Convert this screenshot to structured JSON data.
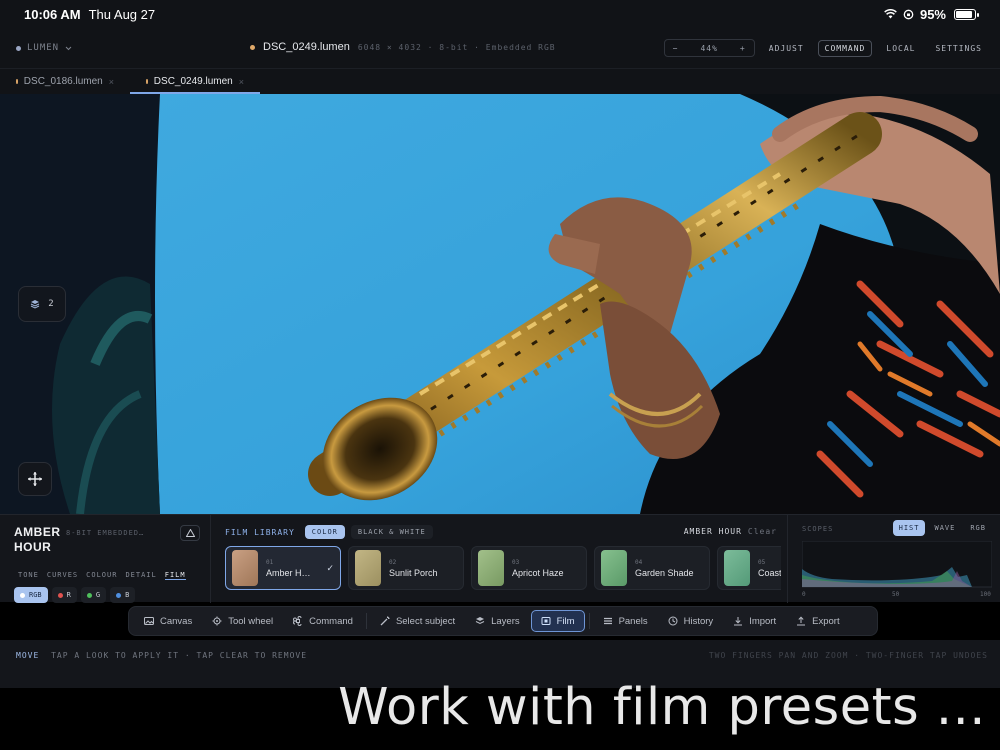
{
  "status_bar": {
    "time": "10:06 AM",
    "date": "Thu Aug 27",
    "battery": "95%",
    "battery_level": 0.95
  },
  "topbar": {
    "app_menu": "LUMEN",
    "doc_name": "DSC_0249.lumen",
    "doc_meta": "6048 × 4032 · 8-bit · Embedded RGB",
    "zoom": {
      "minus": "−",
      "value": "44%",
      "plus": "+"
    },
    "links": {
      "adjust": "ADJUST",
      "command": "COMMAND",
      "local": "LOCAL",
      "settings": "SETTINGS"
    }
  },
  "tabs": [
    {
      "name": "DSC_0186.lumen",
      "close": "×",
      "dot_color": "#e0a96a"
    },
    {
      "name": "DSC_0249.lumen",
      "close": "×",
      "dot_color": "#e0a96a"
    }
  ],
  "canvas": {
    "layers_count": "2"
  },
  "look": {
    "name": "AMBER HOUR",
    "meta": "8-BIT EMBEDDED…",
    "tabs": [
      "TONE",
      "CURVES",
      "COLOUR",
      "DETAIL",
      "FILM"
    ],
    "channels": [
      {
        "label": "RGB",
        "color": "#ffffff"
      },
      {
        "label": "R",
        "color": "#e0524f"
      },
      {
        "label": "G",
        "color": "#4fbf5c"
      },
      {
        "label": "B",
        "color": "#4f8fe0"
      }
    ]
  },
  "film_library": {
    "title": "FILM LIBRARY",
    "filters": [
      "COLOR",
      "BLACK & WHITE"
    ],
    "current": "AMBER HOUR",
    "clear": "Clear",
    "presets": [
      {
        "num": "01",
        "name": "Amber H…",
        "color": "#b99273"
      },
      {
        "num": "02",
        "name": "Sunlit Porch",
        "color": "#b2a777"
      },
      {
        "num": "03",
        "name": "Apricot Haze",
        "color": "#8fb07a"
      },
      {
        "num": "04",
        "name": "Garden Shade",
        "color": "#6fae7a"
      },
      {
        "num": "05",
        "name": "Coasta",
        "color": "#6aa889"
      }
    ]
  },
  "scopes": {
    "title": "SCOPES",
    "tabs": [
      "HIST",
      "WAVE",
      "RGB"
    ],
    "axis": [
      "0",
      "50",
      "100"
    ]
  },
  "toolbar": {
    "canvas": "Canvas",
    "tool_wheel": "Tool wheel",
    "command": "Command",
    "select_subject": "Select subject",
    "layers": "Layers",
    "film": "Film",
    "panels": "Panels",
    "history": "History",
    "import": "Import",
    "export": "Export"
  },
  "hint": {
    "mode": "MOVE",
    "text": "TAP A LOOK TO APPLY IT · TAP CLEAR TO REMOVE",
    "right": "TWO FINGERS PAN AND ZOOM · TWO-FINGER TAP UNDOES"
  },
  "caption": "Work with film presets ..."
}
